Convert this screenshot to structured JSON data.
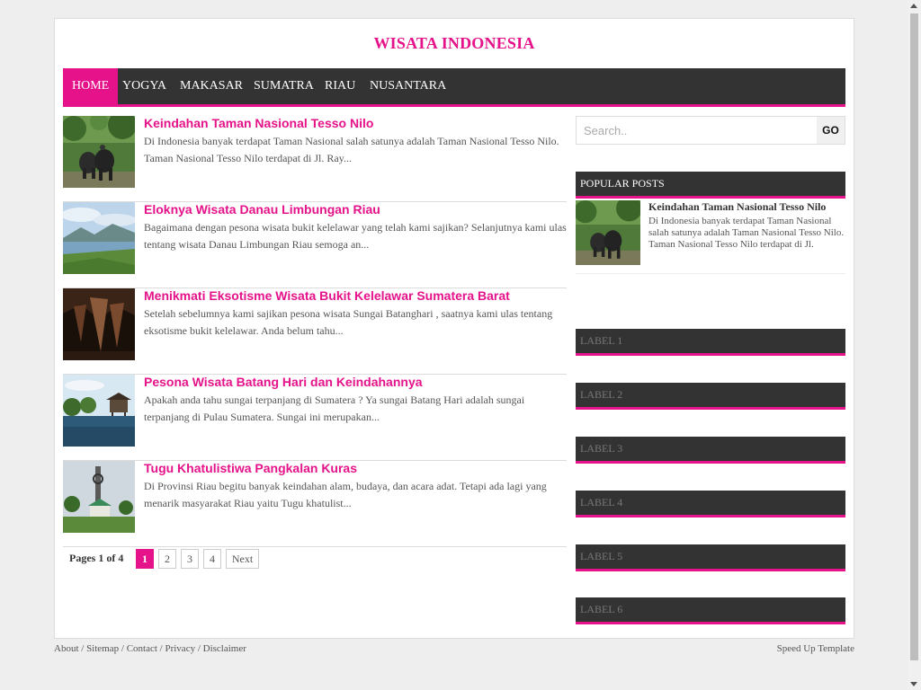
{
  "site": {
    "title": "WISATA INDONESIA"
  },
  "nav": {
    "items": [
      {
        "label": "HOME",
        "active": true
      },
      {
        "label": "YOGYA"
      },
      {
        "label": "MAKASAR"
      },
      {
        "label": "SUMATRA"
      },
      {
        "label": "RIAU"
      },
      {
        "label": "NUSANTARA"
      }
    ]
  },
  "posts": [
    {
      "title": "Keindahan Taman Nasional Tesso Nilo",
      "excerpt": "Di Indonesia banyak terdapat Taman Nasional salah satunya adalah Taman Nasional Tesso Nilo. Taman Nasional Tesso Nilo terdapat di Jl. Ray...",
      "thumb_icon": "elephant-forest-thumb"
    },
    {
      "title": "Eloknya Wisata Danau Limbungan Riau",
      "excerpt": "Bagaimana dengan pesona wisata bukit kelelawar yang telah kami sajikan? Selanjutnya kami ulas tentang wisata Danau Limbungan Riau semoga an...",
      "thumb_icon": "lake-thumb"
    },
    {
      "title": "Menikmati Eksotisme Wisata Bukit Kelelawar Sumatera Barat",
      "excerpt": "Setelah sebelumnya kami sajikan pesona wisata Sungai Batanghari , saatnya kami ulas tentang eksotisme bukit kelelawar. Anda belum tahu...",
      "thumb_icon": "cave-thumb"
    },
    {
      "title": "Pesona Wisata Batang Hari dan Keindahannya",
      "excerpt": "Apakah anda tahu sungai terpanjang di Sumatera ? Ya sungai Batang Hari adalah sungai terpanjang di Pulau Sumatera. Sungai ini merupakan...",
      "thumb_icon": "river-house-thumb"
    },
    {
      "title": "Tugu Khatulistiwa Pangkalan Kuras",
      "excerpt": "Di Provinsi Riau begitu banyak keindahan alam, budaya, dan acara adat. Tetapi ada lagi yang menarik masyarakat Riau yaitu Tugu khatulist...",
      "thumb_icon": "monument-thumb"
    }
  ],
  "pagination": {
    "label": "Pages 1 of 4",
    "pages": [
      "1",
      "2",
      "3",
      "4"
    ],
    "current": "1",
    "next": "Next"
  },
  "search": {
    "placeholder": "Search..",
    "button": "GO"
  },
  "popular": {
    "heading": "POPULAR POSTS",
    "items": [
      {
        "title": "Keindahan Taman Nasional Tesso Nilo",
        "excerpt": "Di Indonesia banyak terdapat Taman Nasional salah satunya adalah Taman Nasional Tesso Nilo. Taman Nasional Tesso Nilo terdapat di Jl."
      }
    ]
  },
  "labels": [
    "LABEL 1",
    "LABEL 2",
    "LABEL 3",
    "LABEL 4",
    "LABEL 5",
    "LABEL 6"
  ],
  "footer": {
    "links": [
      "About",
      "Sitemap",
      "Contact",
      "Privacy",
      "Disclaimer"
    ],
    "separator": " / ",
    "credit": "Speed Up Template"
  },
  "colors": {
    "accent": "#e5128a",
    "nav_bg": "#333333",
    "page_bg": "#eeeeee"
  }
}
